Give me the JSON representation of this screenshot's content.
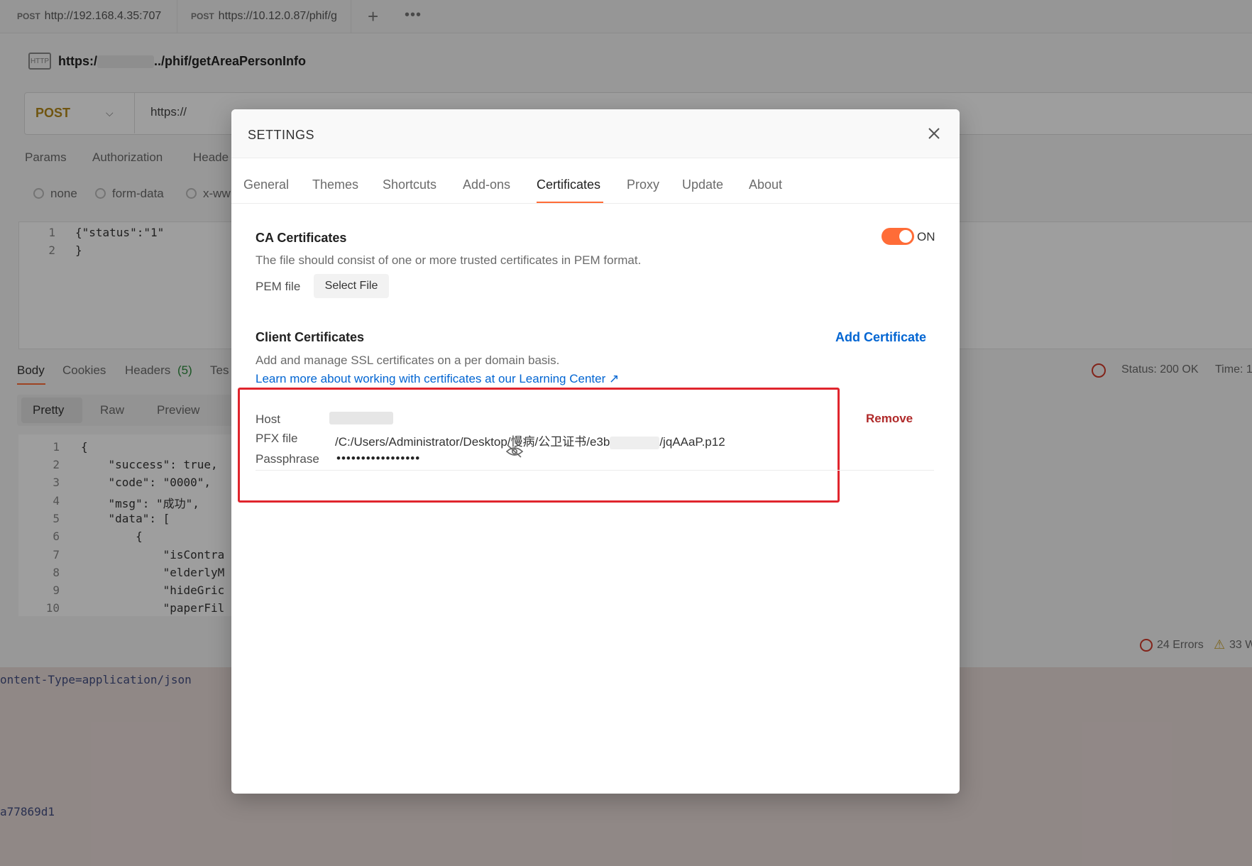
{
  "tabs": [
    {
      "method": "POST",
      "url": "http://192.168.4.35:707"
    },
    {
      "method": "POST",
      "url": "https://10.12.0.87/phif/g"
    }
  ],
  "request": {
    "title_prefix": "https:/",
    "title_suffix": "../phif/getAreaPersonInfo",
    "method": "POST",
    "url_prefix": "https://"
  },
  "req_tabs": [
    "Params",
    "Authorization",
    "Heade"
  ],
  "body_types": [
    "none",
    "form-data",
    "x-ww"
  ],
  "request_body": {
    "lines": [
      "{\"status\":\"1\"",
      "}"
    ]
  },
  "resp_tabs": [
    "Body",
    "Cookies",
    "Headers",
    "(5)",
    "Tes"
  ],
  "resp_views": [
    "Pretty",
    "Raw",
    "Preview"
  ],
  "response_body": {
    "lines": [
      "{",
      "    \"success\": true,",
      "    \"code\": \"0000\",",
      "    \"msg\": \"成功\",",
      "    \"data\": [",
      "        {",
      "            \"isContra",
      "            \"elderlyM",
      "            \"hideGric",
      "            \"paperFil"
    ]
  },
  "status": {
    "text": "Status: 200 OK",
    "time": "Time: 1",
    "errors": "24 Errors",
    "warnings": "33 W"
  },
  "console": {
    "line1": "ontent-Type=application/json",
    "line2": "a77869d1"
  },
  "settings": {
    "title": "SETTINGS",
    "tabs": [
      "General",
      "Themes",
      "Shortcuts",
      "Add-ons",
      "Certificates",
      "Proxy",
      "Update",
      "About"
    ],
    "ca": {
      "heading": "CA Certificates",
      "toggle": "ON",
      "description": "The file should consist of one or more trusted certificates in PEM format.",
      "pem_label": "PEM file",
      "select_file": "Select File"
    },
    "client": {
      "heading": "Client Certificates",
      "add": "Add Certificate",
      "description": "Add and manage SSL certificates on a per domain basis.",
      "learn_more": "Learn more about working with certificates at our Learning Center ↗"
    },
    "cert": {
      "host_label": "Host",
      "pfx_label": "PFX file",
      "pfx_value_a": "/C:/Users/Administrator/Desktop/慢病/公卫证书/e3b",
      "pfx_value_b": "/jqAAaP.p12",
      "passphrase_label": "Passphrase",
      "passphrase_value": "•••••••••••••••••",
      "remove": "Remove"
    }
  },
  "colors": {
    "accent": "#ff6c37",
    "link": "#0265d2",
    "remove": "#b02a2a",
    "highlight": "#e0252d"
  }
}
